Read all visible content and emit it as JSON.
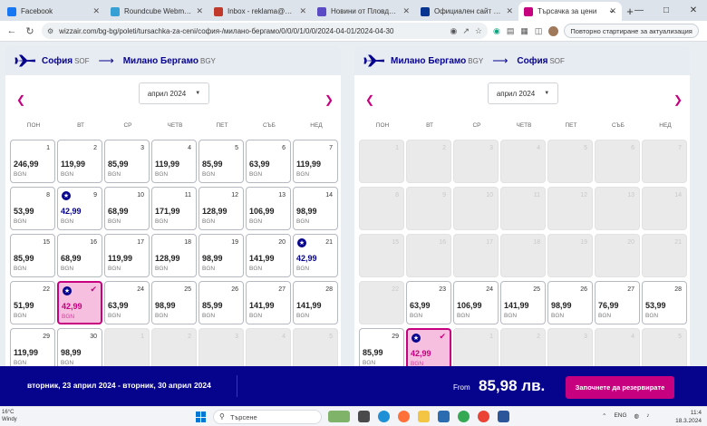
{
  "browser": {
    "tabs": [
      {
        "title": "Facebook",
        "icon": "facebook-icon",
        "color": "#1877f2"
      },
      {
        "title": "Roundcube Webmail :: Int…",
        "icon": "roundcube-icon",
        "color": "#37a0d4"
      },
      {
        "title": "Inbox - reklama@poctep…",
        "icon": "mail-icon",
        "color": "#c0392b"
      },
      {
        "title": "Новини от Пловдив - Ак…",
        "icon": "news-icon",
        "color": "#5b4bc4"
      },
      {
        "title": "Официален сайт Ryanair …",
        "icon": "ryanair-icon",
        "color": "#073590"
      },
      {
        "title": "Търсачка за цени",
        "icon": "wizzair-icon",
        "color": "#c6007e",
        "active": true
      }
    ],
    "url": "wizzair.com/bg-bg/poleti/tursachka-za-ceni/софия-/милано-бергамо/0/0/0/1/0/0/2024-04-01/2024-04-30",
    "update_button": "Повторно стартиране за актуализация"
  },
  "weekdays": [
    "ПОН",
    "ВТ",
    "СР",
    "ЧЕТВ",
    "ПЕТ",
    "СЪБ",
    "НЕД"
  ],
  "outbound": {
    "from_city": "София",
    "from_code": "SOF",
    "to_city": "Милано Бергамо",
    "to_code": "BGY",
    "month": "април 2024",
    "currency": "BGN",
    "days": [
      {
        "d": "1",
        "p": "246,99"
      },
      {
        "d": "2",
        "p": "119,99"
      },
      {
        "d": "3",
        "p": "85,99"
      },
      {
        "d": "4",
        "p": "119,99"
      },
      {
        "d": "5",
        "p": "85,99"
      },
      {
        "d": "6",
        "p": "63,99"
      },
      {
        "d": "7",
        "p": "119,99"
      },
      {
        "d": "8",
        "p": "53,99"
      },
      {
        "d": "9",
        "p": "42,99",
        "star": true
      },
      {
        "d": "10",
        "p": "68,99"
      },
      {
        "d": "11",
        "p": "171,99"
      },
      {
        "d": "12",
        "p": "128,99"
      },
      {
        "d": "13",
        "p": "106,99"
      },
      {
        "d": "14",
        "p": "98,99"
      },
      {
        "d": "15",
        "p": "85,99"
      },
      {
        "d": "16",
        "p": "68,99"
      },
      {
        "d": "17",
        "p": "119,99"
      },
      {
        "d": "18",
        "p": "128,99"
      },
      {
        "d": "19",
        "p": "98,99"
      },
      {
        "d": "20",
        "p": "141,99"
      },
      {
        "d": "21",
        "p": "42,99",
        "star": true
      },
      {
        "d": "22",
        "p": "51,99"
      },
      {
        "d": "23",
        "p": "42,99",
        "star": true,
        "selected": true
      },
      {
        "d": "24",
        "p": "63,99"
      },
      {
        "d": "25",
        "p": "98,99"
      },
      {
        "d": "26",
        "p": "85,99"
      },
      {
        "d": "27",
        "p": "141,99"
      },
      {
        "d": "28",
        "p": "141,99"
      },
      {
        "d": "29",
        "p": "119,99"
      },
      {
        "d": "30",
        "p": "98,99"
      },
      {
        "d": "1",
        "disabled": true
      },
      {
        "d": "2",
        "disabled": true
      },
      {
        "d": "3",
        "disabled": true
      },
      {
        "d": "4",
        "disabled": true
      },
      {
        "d": "5",
        "disabled": true
      }
    ]
  },
  "inbound": {
    "from_city": "Милано Бергамо",
    "from_code": "BGY",
    "to_city": "София",
    "to_code": "SOF",
    "month": "април 2024",
    "currency": "BGN",
    "days": [
      {
        "d": "1",
        "disabled": true
      },
      {
        "d": "2",
        "disabled": true
      },
      {
        "d": "3",
        "disabled": true
      },
      {
        "d": "4",
        "disabled": true
      },
      {
        "d": "5",
        "disabled": true
      },
      {
        "d": "6",
        "disabled": true
      },
      {
        "d": "7",
        "disabled": true
      },
      {
        "d": "8",
        "disabled": true
      },
      {
        "d": "9",
        "disabled": true
      },
      {
        "d": "10",
        "disabled": true
      },
      {
        "d": "11",
        "disabled": true
      },
      {
        "d": "12",
        "disabled": true
      },
      {
        "d": "13",
        "disabled": true
      },
      {
        "d": "14",
        "disabled": true
      },
      {
        "d": "15",
        "disabled": true
      },
      {
        "d": "16",
        "disabled": true
      },
      {
        "d": "17",
        "disabled": true
      },
      {
        "d": "18",
        "disabled": true
      },
      {
        "d": "19",
        "disabled": true
      },
      {
        "d": "20",
        "disabled": true
      },
      {
        "d": "21",
        "disabled": true
      },
      {
        "d": "22",
        "disabled": true
      },
      {
        "d": "23",
        "p": "63,99"
      },
      {
        "d": "24",
        "p": "106,99"
      },
      {
        "d": "25",
        "p": "141,99"
      },
      {
        "d": "26",
        "p": "98,99"
      },
      {
        "d": "27",
        "p": "76,99"
      },
      {
        "d": "28",
        "p": "53,99"
      },
      {
        "d": "29",
        "p": "85,99"
      },
      {
        "d": "30",
        "p": "42,99",
        "star": true,
        "selected": true
      },
      {
        "d": "1",
        "disabled": true
      },
      {
        "d": "2",
        "disabled": true
      },
      {
        "d": "3",
        "disabled": true
      },
      {
        "d": "4",
        "disabled": true
      },
      {
        "d": "5",
        "disabled": true
      }
    ]
  },
  "booking": {
    "dates": "вторник, 23 април 2024 - вторник, 30 април 2024",
    "from_label": "From",
    "total": "85,98 лв.",
    "cta": "Започнете да резервирате"
  },
  "taskbar": {
    "temp": "16°C",
    "weather": "Windy",
    "search": "Търсене",
    "lang": "ENG",
    "time": "11:4",
    "date": "18.3.2024"
  },
  "colors": {
    "brand_navy": "#06038d",
    "brand_magenta": "#c6007e",
    "selected_fill": "#f6bfe0"
  }
}
